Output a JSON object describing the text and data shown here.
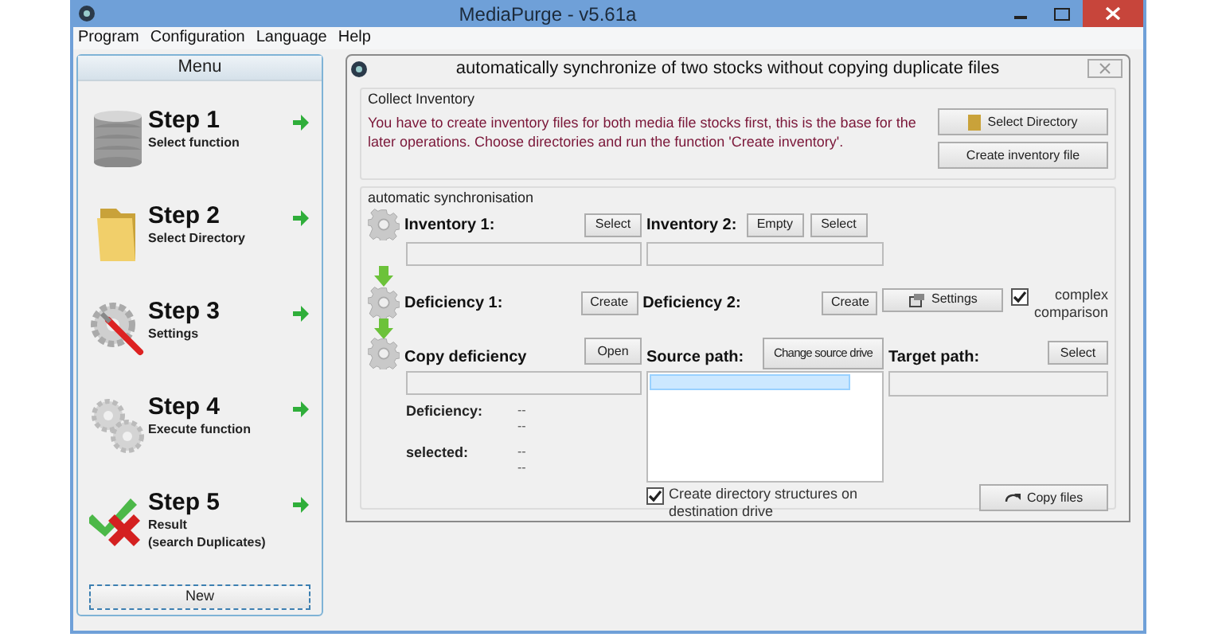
{
  "window": {
    "title": "MediaPurge - v5.61a"
  },
  "menu_bar": [
    "Program",
    "Configuration",
    "Language",
    "Help"
  ],
  "sidebar": {
    "title": "Menu",
    "steps": [
      {
        "title": "Step 1",
        "subtitle": [
          "Select function"
        ]
      },
      {
        "title": "Step 2",
        "subtitle": [
          "Select Directory"
        ]
      },
      {
        "title": "Step 3",
        "subtitle": [
          "Settings"
        ]
      },
      {
        "title": "Step 4",
        "subtitle": [
          "Execute function"
        ]
      },
      {
        "title": "Step 5",
        "subtitle": [
          "Result",
          "(search Duplicates)"
        ]
      }
    ],
    "new_button": "New"
  },
  "dialog": {
    "title": "automatically synchronize of two stocks without copying duplicate files",
    "collect_inventory": {
      "legend": "Collect Inventory",
      "text": "You have to create inventory files for both media file stocks first, this is the base for the later operations. Choose directories and run the function 'Create inventory'.",
      "buttons": [
        "Select Directory",
        "Create inventory file"
      ]
    },
    "sync": {
      "legend": "automatic synchronisation",
      "inventory_1": {
        "label": "Inventory 1:",
        "buttons": [
          "Select"
        ]
      },
      "inventory_2": {
        "label": "Inventory 2:",
        "buttons": [
          "Empty",
          "Select"
        ]
      },
      "deficiency_1": {
        "label": "Deficiency 1:",
        "buttons": [
          "Create"
        ]
      },
      "deficiency_2": {
        "label": "Deficiency 2:",
        "buttons": [
          "Create",
          "Settings"
        ],
        "checkbox": {
          "label": [
            "complex",
            "comparison"
          ],
          "checked": true
        }
      },
      "copy_deficiency": {
        "label": "Copy deficiency",
        "buttons": [
          "Open"
        ]
      },
      "stats": [
        {
          "label": "Deficiency:",
          "values": [
            "--",
            "--"
          ]
        },
        {
          "label": "selected:",
          "values": [
            "--",
            "--"
          ]
        }
      ],
      "source_path": {
        "label": "Source path:",
        "button": "Change source drive",
        "checkbox": {
          "label": [
            "Create directory structures on",
            "destination drive"
          ],
          "checked": true
        }
      },
      "target_path": {
        "label": "Target path:",
        "button": "Select",
        "copy_button": "Copy files"
      }
    }
  }
}
